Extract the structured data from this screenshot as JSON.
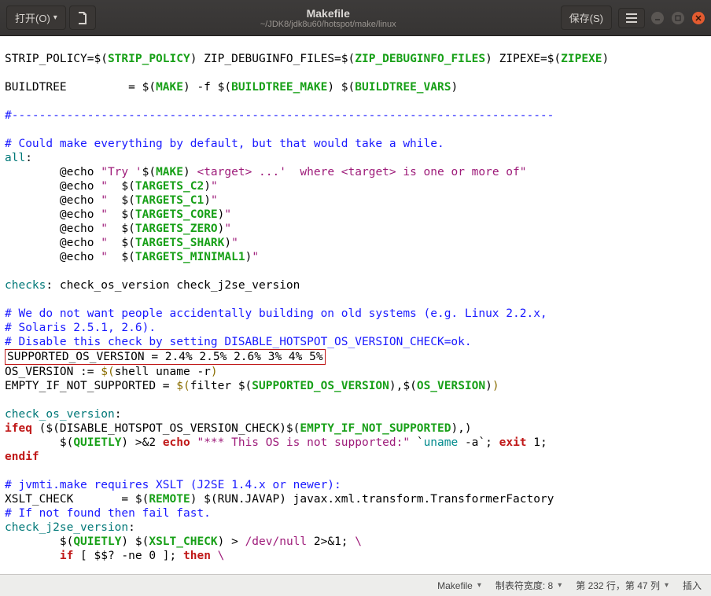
{
  "titlebar": {
    "open": "打开(O)",
    "save": "保存(S)",
    "title": "Makefile",
    "subtitle": "~/JDK8/jdk8u60/hotspot/make/linux"
  },
  "statusbar": {
    "filetype": "Makefile",
    "tabwidth": "制表符宽度: 8",
    "position": "第 232 行，第 47 列",
    "mode": "插入"
  },
  "code": {
    "l0a": "STRIP_POLICY=$(",
    "l0b": "STRIP_POLICY",
    "l0c": ") ZIP_DEBUGINFO_FILES=$(",
    "l0d": "ZIP_DEBUGINFO_FILES",
    "l0e": ") ZIPEXE=$(",
    "l0f": "ZIPEXE",
    "l0g": ")",
    "l2a": "BUILDTREE         = $(",
    "l2b": "MAKE",
    "l2c": ") -f $(",
    "l2d": "BUILDTREE_MAKE",
    "l2e": ") $(",
    "l2f": "BUILDTREE_VARS",
    "l2g": ")",
    "l4": "#-------------------------------------------------------------------------------",
    "l5": "# Could make everything by default, but that would take a while.",
    "l6a": "all",
    "l6b": ":",
    "l7a": "        @echo ",
    "l7b": "\"Try '",
    "l7c": "$(",
    "l7d": "MAKE",
    "l7e": ") ",
    "l7f": "<target> ...'  where <target> is one or more of\"",
    "l8a": "        @echo ",
    "l8b": "\"  ",
    "l8c": "$(",
    "l8d": "TARGETS_C2",
    "l8e": ")",
    "l8f": "\"",
    "l9a": "        @echo ",
    "l9b": "\"  ",
    "l9c": "$(",
    "l9d": "TARGETS_C1",
    "l9e": ")",
    "l9f": "\"",
    "l10a": "        @echo ",
    "l10b": "\"  ",
    "l10c": "$(",
    "l10d": "TARGETS_CORE",
    "l10e": ")",
    "l10f": "\"",
    "l11a": "        @echo ",
    "l11b": "\"  ",
    "l11c": "$(",
    "l11d": "TARGETS_ZERO",
    "l11e": ")",
    "l11f": "\"",
    "l12a": "        @echo ",
    "l12b": "\"  ",
    "l12c": "$(",
    "l12d": "TARGETS_SHARK",
    "l12e": ")",
    "l12f": "\"",
    "l13a": "        @echo ",
    "l13b": "\"  ",
    "l13c": "$(",
    "l13d": "TARGETS_MINIMAL1",
    "l13e": ")",
    "l13f": "\"",
    "l15a": "checks",
    "l15b": ": check_os_version check_j2se_version",
    "l17": "# We do not want people accidentally building on old systems (e.g. Linux 2.2.x,",
    "l18": "# Solaris 2.5.1, 2.6).",
    "l19": "# Disable this check by setting DISABLE_HOTSPOT_OS_VERSION_CHECK=ok.",
    "l20": "SUPPORTED_OS_VERSION = 2.4% 2.5% 2.6% 3% 4% 5%",
    "l21a": "OS_VERSION := ",
    "l21b": "$(",
    "l21c": "shell uname -r",
    "l21d": ")",
    "l22a": "EMPTY_IF_NOT_SUPPORTED = ",
    "l22b": "$(",
    "l22c": "filter ",
    "l22d": "$(",
    "l22e": "SUPPORTED_OS_VERSION",
    "l22f": ")",
    "l22g": ",",
    "l22h": "$(",
    "l22i": "OS_VERSION",
    "l22j": ")",
    "l22k": ")",
    "l24a": "check_os_version",
    "l24b": ":",
    "l25a": "ifeq",
    "l25b": " ($(DISABLE_HOTSPOT_OS_VERSION_CHECK)$(",
    "l25c": "EMPTY_IF_NOT_SUPPORTED",
    "l25d": "),)",
    "l26a": "        $(",
    "l26b": "QUIETLY",
    "l26c": ") >&2 ",
    "l26d": "echo",
    "l26e": " ",
    "l26f": "\"*** This OS is not supported:\"",
    "l26g": " `",
    "l26h": "uname",
    "l26i": " -a`; ",
    "l26j": "exit",
    "l26k": " 1;",
    "l27": "endif",
    "l29": "# jvmti.make requires XSLT (J2SE 1.4.x or newer):",
    "l30a": "XSLT_CHECK       = $(",
    "l30b": "REMOTE",
    "l30c": ") $(RUN.JAVAP) javax.xml.transform.TransformerFactory",
    "l31": "# If not found then fail fast.",
    "l32a": "check_j2se_version",
    "l32b": ":",
    "l33a": "        $(",
    "l33b": "QUIETLY",
    "l33c": ") $(",
    "l33d": "XSLT_CHECK",
    "l33e": ") > ",
    "l33f": "/dev/null",
    "l33g": " 2>&1; ",
    "l33h": "\\",
    "l34a": "        ",
    "l34b": "if",
    "l34c": " [ $$? -ne 0 ]; ",
    "l34d": "then",
    "l34e": " ",
    "l34f": "\\"
  }
}
